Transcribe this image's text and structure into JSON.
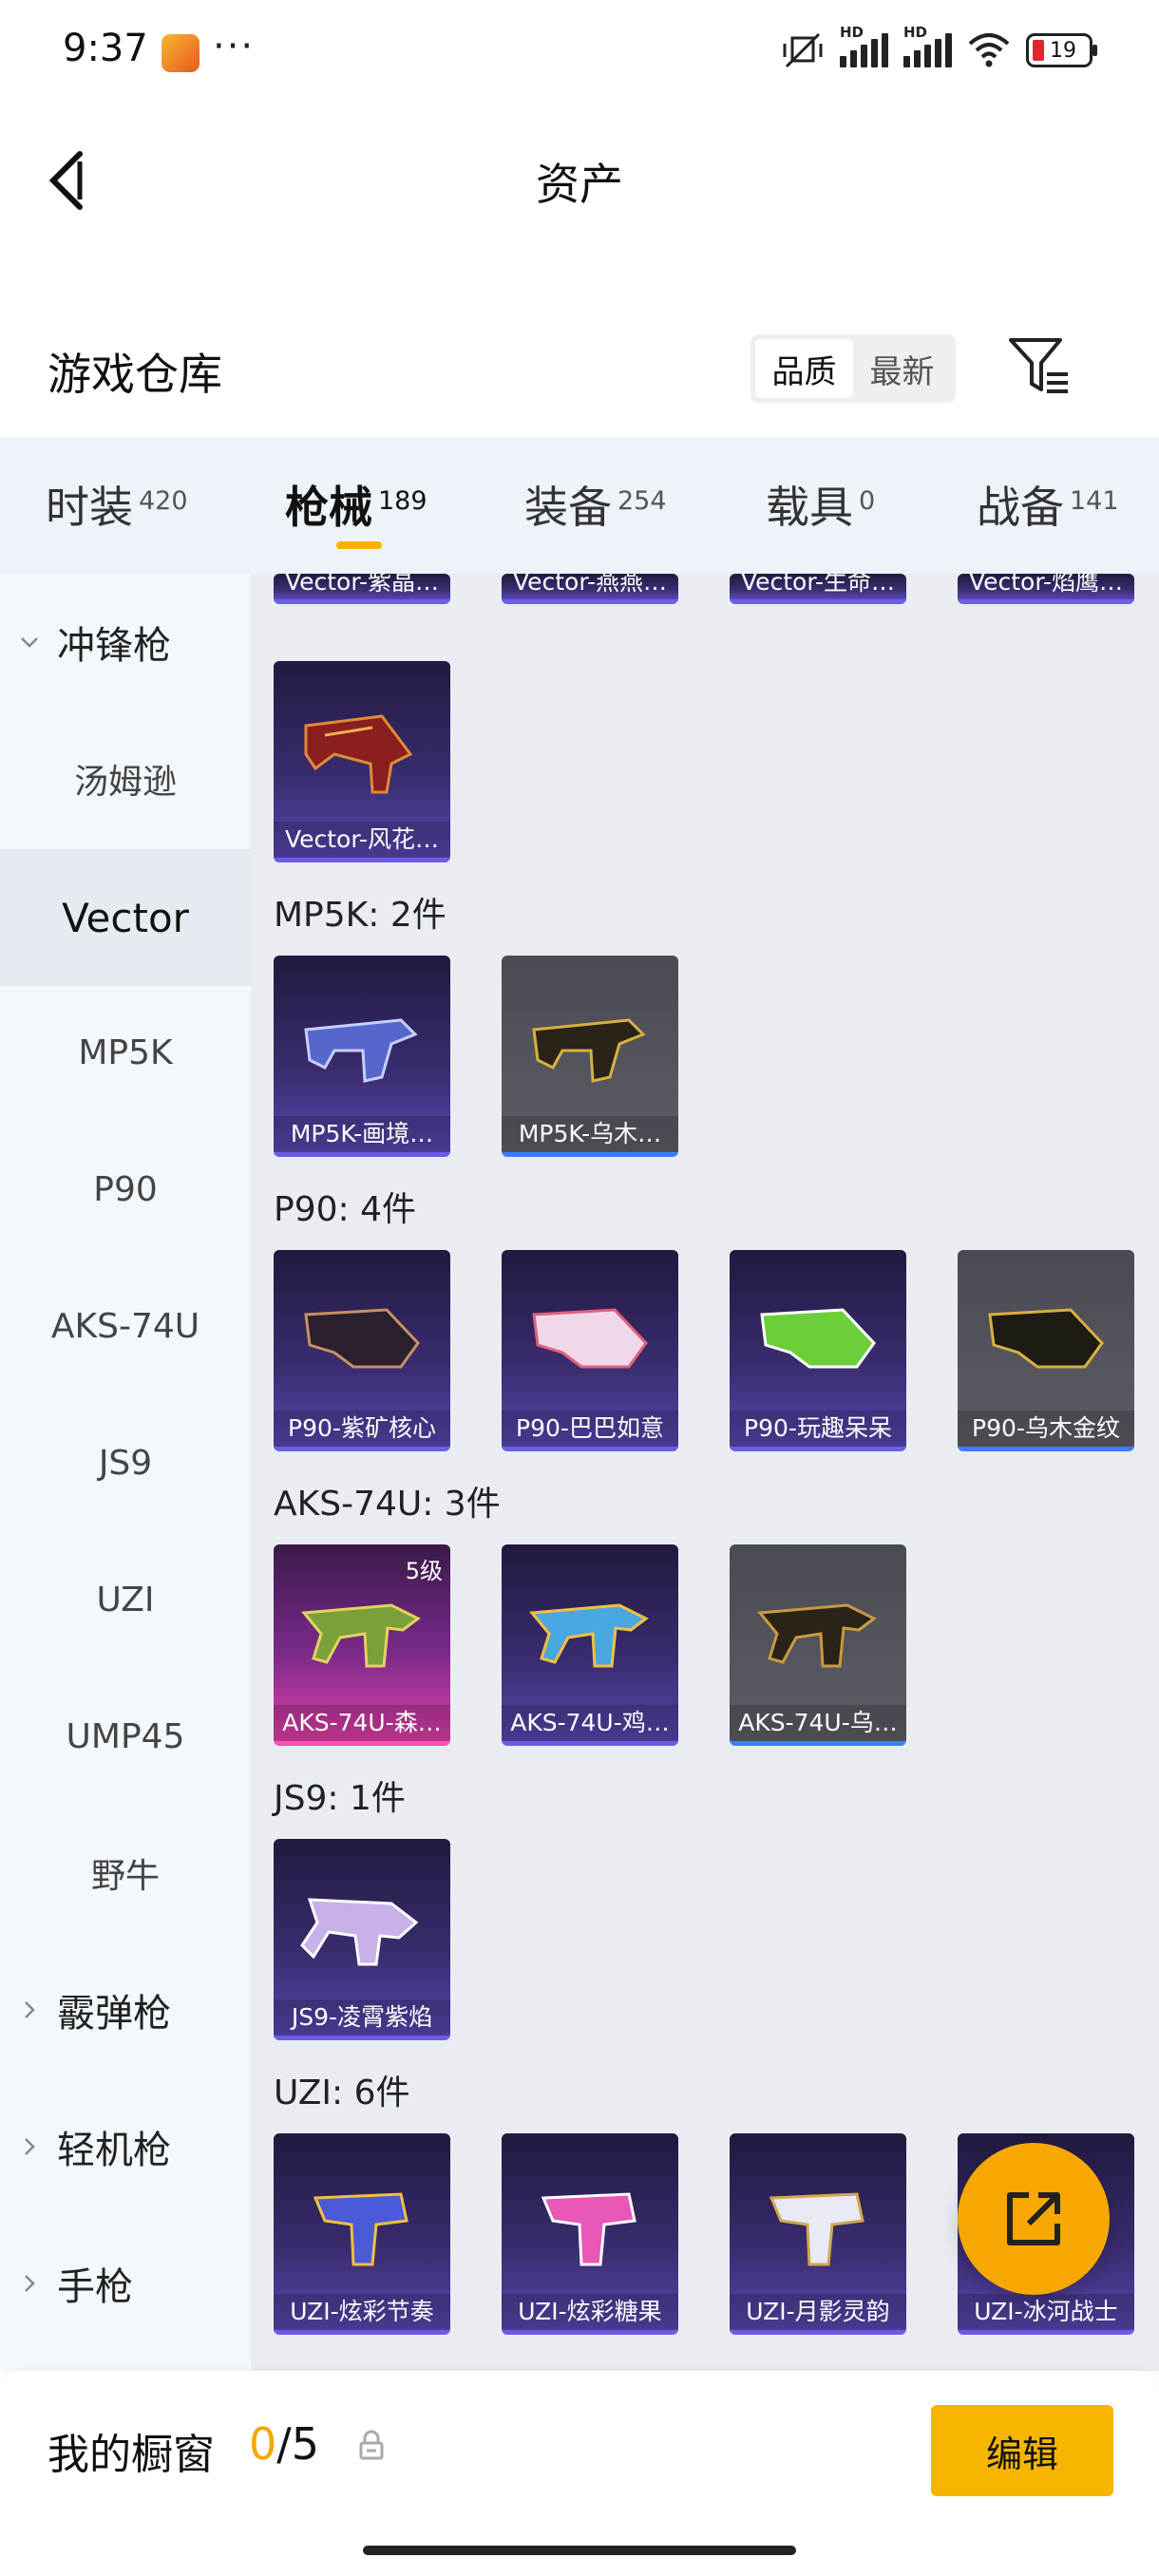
{
  "status_bar": {
    "time": "9:37",
    "dots": "···",
    "battery": "19",
    "hd1": "HD",
    "hd2": "HD"
  },
  "header": {
    "title": "资产"
  },
  "warehouse": {
    "title": "游戏仓库",
    "sort_options": [
      "品质",
      "最新"
    ],
    "sort_selected": "品质"
  },
  "tabs": [
    {
      "label": "时装",
      "count": "420"
    },
    {
      "label": "枪械",
      "count": "189"
    },
    {
      "label": "装备",
      "count": "254"
    },
    {
      "label": "载具",
      "count": "0"
    },
    {
      "label": "战备",
      "count": "141"
    }
  ],
  "active_tab": "枪械",
  "sidebar": {
    "items": [
      {
        "label": "冲锋枪",
        "type": "category",
        "expanded": true
      },
      {
        "label": "汤姆逊",
        "type": "sub"
      },
      {
        "label": "Vector",
        "type": "sub",
        "active": true
      },
      {
        "label": "MP5K",
        "type": "sub"
      },
      {
        "label": "P90",
        "type": "sub"
      },
      {
        "label": "AKS-74U",
        "type": "sub"
      },
      {
        "label": "JS9",
        "type": "sub"
      },
      {
        "label": "UZI",
        "type": "sub"
      },
      {
        "label": "UMP45",
        "type": "sub"
      },
      {
        "label": "野牛",
        "type": "sub"
      },
      {
        "label": "霰弹枪",
        "type": "category",
        "expanded": false
      },
      {
        "label": "轻机枪",
        "type": "category",
        "expanded": false
      },
      {
        "label": "手枪",
        "type": "category",
        "expanded": false
      }
    ]
  },
  "content": {
    "vector_partial": [
      "Vector-紫晶…",
      "Vector-燕燕…",
      "Vector-生命…",
      "Vector-焰鹰…"
    ],
    "vector_card": {
      "name": "Vector-风花…"
    },
    "groups": [
      {
        "title": "MP5K: 2件",
        "items": [
          {
            "name": "MP5K-画境…",
            "rarity": "purple"
          },
          {
            "name": "MP5K-乌木…",
            "rarity": "grey"
          }
        ]
      },
      {
        "title": "P90: 4件",
        "items": [
          {
            "name": "P90-紫矿核心",
            "rarity": "purple"
          },
          {
            "name": "P90-巴巴如意",
            "rarity": "purple"
          },
          {
            "name": "P90-玩趣呆呆",
            "rarity": "purple"
          },
          {
            "name": "P90-乌木金纹",
            "rarity": "grey"
          }
        ]
      },
      {
        "title": "AKS-74U: 3件",
        "items": [
          {
            "name": "AKS-74U-森…",
            "rarity": "pink",
            "level": "5级"
          },
          {
            "name": "AKS-74U-鸡…",
            "rarity": "purple"
          },
          {
            "name": "AKS-74U-乌…",
            "rarity": "grey"
          }
        ]
      },
      {
        "title": "JS9: 1件",
        "items": [
          {
            "name": "JS9-凌霄紫焰",
            "rarity": "purple"
          }
        ]
      },
      {
        "title": "UZI: 6件",
        "items": [
          {
            "name": "UZI-炫彩节奏",
            "rarity": "purple"
          },
          {
            "name": "UZI-炫彩糖果",
            "rarity": "purple"
          },
          {
            "name": "UZI-月影灵韵",
            "rarity": "purple"
          },
          {
            "name": "UZI-冰河战士",
            "rarity": "purple"
          }
        ]
      }
    ]
  },
  "showcase": {
    "label": "我的橱窗",
    "current": "0",
    "total": "/5",
    "edit_label": "编辑"
  },
  "colors": {
    "accent": "#f8b500",
    "purple_card": "#3a2d70",
    "grey_card": "#5d5d66",
    "pink_card": "#e13fa8"
  }
}
